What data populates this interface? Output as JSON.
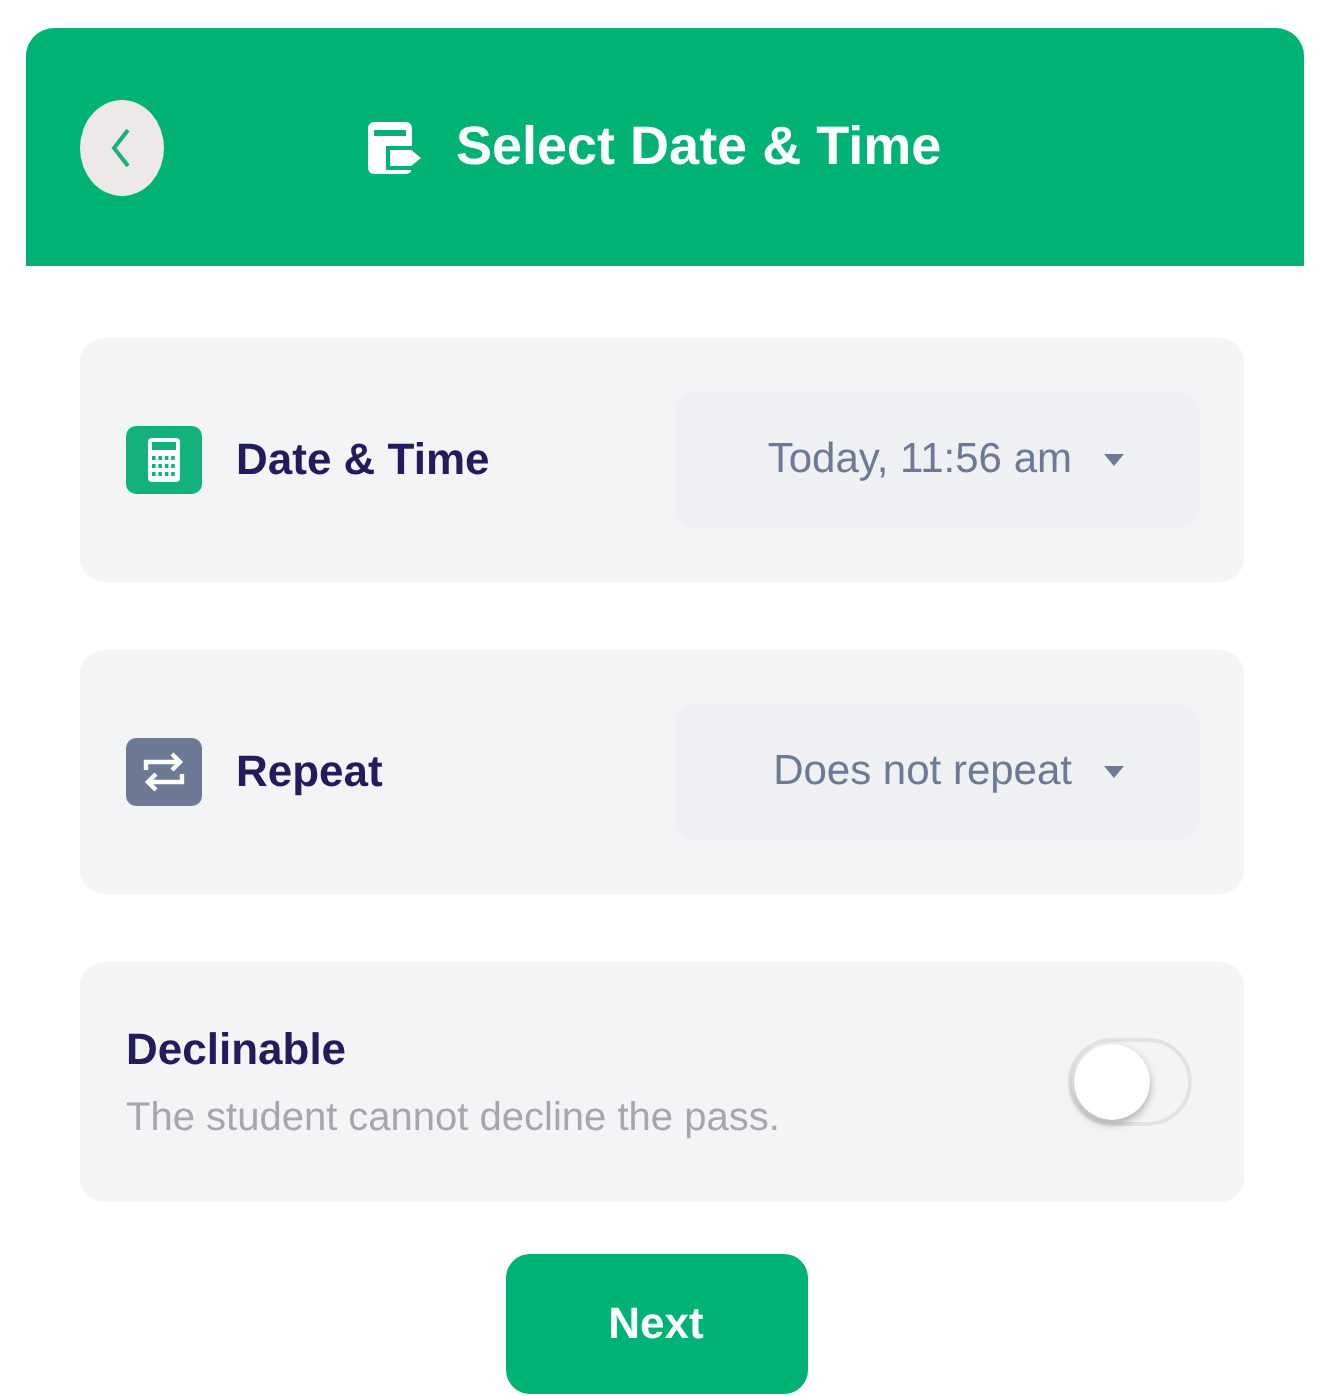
{
  "header": {
    "title": "Select Date & Time"
  },
  "settings": [
    {
      "kind": "date",
      "label": "Date & Time",
      "value": "Today, 11:56 am"
    },
    {
      "kind": "repeat",
      "label": "Repeat",
      "value": "Does not repeat"
    }
  ],
  "declinable": {
    "title": "Declinable",
    "description": "The student cannot decline the pass.",
    "on": false
  },
  "next_button": "Next"
}
